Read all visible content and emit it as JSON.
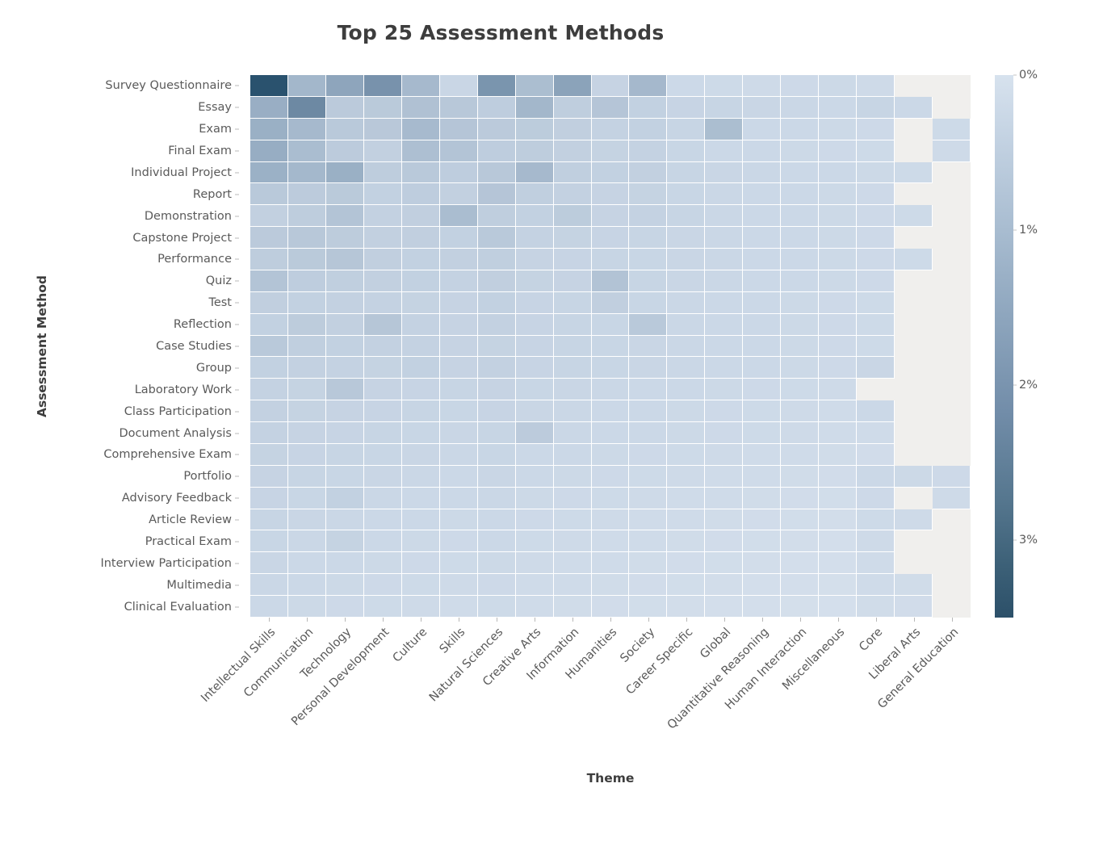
{
  "chart_data": {
    "type": "heatmap",
    "title": "Top 25 Assessment Methods",
    "xlabel": "Theme",
    "ylabel": "Assessment Method",
    "grid": false,
    "legend_position": "right",
    "colorbar": {
      "title": "",
      "orientation": "vertical",
      "reversed": true,
      "range": [
        0,
        3.5
      ],
      "unit": "%",
      "tick_labels": [
        "0%",
        "1%",
        "2%",
        "3%"
      ],
      "tick_values": [
        0,
        1,
        2,
        3
      ],
      "low_color": "#dbe4ef",
      "high_color": "#2c5069",
      "missing_color": "#f0efed"
    },
    "x_categories": [
      "Intellectual Skills",
      "Communication",
      "Technology",
      "Personal Development",
      "Culture",
      "Skills",
      "Natural Sciences",
      "Creative Arts",
      "Information",
      "Humanities",
      "Society",
      "Career Specific",
      "Global",
      "Quantitative Reasoning",
      "Human Interaction",
      "Miscellaneous",
      "Core",
      "Liberal Arts",
      "General Education"
    ],
    "y_categories": [
      "Survey Questionnaire",
      "Essay",
      "Exam",
      "Final Exam",
      "Individual Project",
      "Report",
      "Demonstration",
      "Capstone Project",
      "Performance",
      "Quiz",
      "Test",
      "Reflection",
      "Case Studies",
      "Group",
      "Laboratory Work",
      "Class Participation",
      "Document Analysis",
      "Comprehensive Exam",
      "Portfolio",
      "Advisory Feedback",
      "Article Review",
      "Practical Exam",
      "Interview Participation",
      "Multimedia",
      "Clinical Evaluation"
    ],
    "values": [
      [
        3.4,
        1.35,
        1.75,
        2.15,
        1.3,
        0.55,
        2.1,
        1.2,
        1.8,
        0.62,
        1.32,
        0.45,
        0.42,
        0.4,
        0.44,
        0.46,
        0.4,
        null,
        null
      ],
      [
        1.55,
        2.35,
        0.88,
        0.9,
        1.12,
        0.95,
        0.8,
        1.35,
        0.78,
        1.02,
        0.7,
        0.6,
        0.58,
        0.54,
        0.52,
        0.5,
        0.58,
        0.48,
        null
      ],
      [
        1.52,
        1.3,
        0.92,
        0.94,
        1.28,
        1.02,
        0.88,
        0.85,
        0.74,
        0.66,
        0.7,
        0.58,
        1.2,
        0.5,
        0.48,
        0.46,
        0.44,
        null,
        0.42
      ],
      [
        1.58,
        1.22,
        0.86,
        0.72,
        1.16,
        1.05,
        0.8,
        0.82,
        0.72,
        0.64,
        0.66,
        0.56,
        0.5,
        0.48,
        0.46,
        0.44,
        0.42,
        null,
        0.4
      ],
      [
        1.5,
        1.34,
        1.52,
        0.82,
        0.92,
        0.8,
        0.95,
        1.3,
        0.76,
        0.7,
        0.72,
        0.58,
        0.54,
        0.52,
        0.5,
        0.48,
        0.46,
        0.42,
        null
      ],
      [
        0.92,
        0.86,
        0.9,
        0.7,
        0.8,
        0.72,
        1.02,
        0.75,
        0.68,
        0.62,
        0.64,
        0.56,
        0.52,
        0.5,
        0.48,
        0.46,
        0.44,
        null,
        null
      ],
      [
        0.72,
        0.82,
        1.05,
        0.68,
        0.74,
        1.22,
        0.78,
        0.7,
        0.85,
        0.62,
        0.66,
        0.58,
        0.52,
        0.5,
        0.48,
        0.46,
        0.44,
        0.42,
        null
      ],
      [
        0.88,
        0.95,
        0.84,
        0.72,
        0.74,
        0.7,
        0.92,
        0.66,
        0.64,
        0.6,
        0.58,
        0.54,
        0.52,
        0.5,
        0.48,
        0.46,
        0.44,
        null,
        null
      ],
      [
        0.82,
        0.9,
        1.0,
        0.74,
        0.7,
        0.72,
        0.76,
        0.62,
        0.6,
        0.58,
        0.56,
        0.54,
        0.52,
        0.5,
        0.48,
        0.46,
        0.44,
        0.42,
        null
      ],
      [
        1.05,
        0.8,
        0.76,
        0.72,
        0.7,
        0.66,
        0.74,
        0.64,
        0.62,
        1.08,
        0.58,
        0.54,
        0.52,
        0.5,
        0.48,
        0.46,
        0.44,
        null,
        null
      ],
      [
        0.74,
        0.7,
        0.68,
        0.66,
        0.64,
        0.62,
        0.7,
        0.6,
        0.58,
        0.74,
        0.56,
        0.52,
        0.5,
        0.48,
        0.46,
        0.44,
        0.42,
        null,
        null
      ],
      [
        0.7,
        0.84,
        0.72,
        1.0,
        0.66,
        0.62,
        0.68,
        0.6,
        0.58,
        0.56,
        0.92,
        0.52,
        0.5,
        0.48,
        0.46,
        0.44,
        0.42,
        null,
        null
      ],
      [
        0.92,
        0.76,
        0.7,
        0.68,
        0.66,
        0.62,
        0.64,
        0.6,
        0.58,
        0.56,
        0.54,
        0.52,
        0.5,
        0.48,
        0.46,
        0.44,
        0.42,
        null,
        null
      ],
      [
        0.7,
        0.68,
        0.66,
        0.64,
        0.7,
        0.62,
        0.68,
        0.6,
        0.58,
        0.56,
        0.54,
        0.52,
        0.5,
        0.48,
        0.46,
        0.44,
        0.54,
        null,
        null
      ],
      [
        0.66,
        0.64,
        0.96,
        0.62,
        0.6,
        0.58,
        0.62,
        0.56,
        0.54,
        0.52,
        0.5,
        0.48,
        0.46,
        0.44,
        0.42,
        0.4,
        null,
        null,
        null
      ],
      [
        0.68,
        0.64,
        0.62,
        0.6,
        0.58,
        0.56,
        0.6,
        0.54,
        0.52,
        0.5,
        0.48,
        0.46,
        0.44,
        0.42,
        0.4,
        0.38,
        0.5,
        null,
        null
      ],
      [
        0.66,
        0.62,
        0.6,
        0.58,
        0.56,
        0.54,
        0.58,
        0.86,
        0.52,
        0.5,
        0.48,
        0.46,
        0.44,
        0.42,
        0.4,
        0.38,
        0.36,
        null,
        null
      ],
      [
        0.64,
        0.6,
        0.58,
        0.56,
        0.54,
        0.52,
        0.56,
        0.5,
        0.48,
        0.46,
        0.44,
        0.42,
        0.4,
        0.38,
        0.36,
        0.34,
        0.32,
        null,
        null
      ],
      [
        0.62,
        0.58,
        0.56,
        0.54,
        0.52,
        0.5,
        0.54,
        0.48,
        0.46,
        0.44,
        0.42,
        0.4,
        0.38,
        0.36,
        0.34,
        0.32,
        0.48,
        0.46,
        0.44
      ],
      [
        0.6,
        0.56,
        0.7,
        0.52,
        0.5,
        0.48,
        0.52,
        0.46,
        0.44,
        0.42,
        0.4,
        0.38,
        0.36,
        0.34,
        0.32,
        0.3,
        0.44,
        null,
        0.4
      ],
      [
        0.58,
        0.54,
        0.52,
        0.5,
        0.48,
        0.46,
        0.5,
        0.44,
        0.42,
        0.4,
        0.38,
        0.36,
        0.34,
        0.32,
        0.3,
        0.28,
        0.42,
        0.4,
        null
      ],
      [
        0.56,
        0.52,
        0.64,
        0.48,
        0.46,
        0.44,
        0.48,
        0.42,
        0.4,
        0.38,
        0.36,
        0.34,
        0.32,
        0.3,
        0.28,
        0.26,
        0.4,
        null,
        null
      ],
      [
        0.54,
        0.5,
        0.48,
        0.46,
        0.44,
        0.42,
        0.46,
        0.4,
        0.38,
        0.36,
        0.34,
        0.32,
        0.3,
        0.28,
        0.26,
        0.24,
        0.38,
        null,
        null
      ],
      [
        0.52,
        0.48,
        0.46,
        0.44,
        0.42,
        0.4,
        0.44,
        0.38,
        0.36,
        0.34,
        0.32,
        0.3,
        0.28,
        0.26,
        0.24,
        0.22,
        0.36,
        0.34,
        null
      ],
      [
        0.5,
        0.46,
        0.44,
        0.42,
        0.4,
        0.38,
        0.42,
        0.36,
        0.34,
        0.32,
        0.3,
        0.28,
        0.26,
        0.24,
        0.22,
        0.2,
        0.34,
        0.32,
        null
      ]
    ]
  }
}
